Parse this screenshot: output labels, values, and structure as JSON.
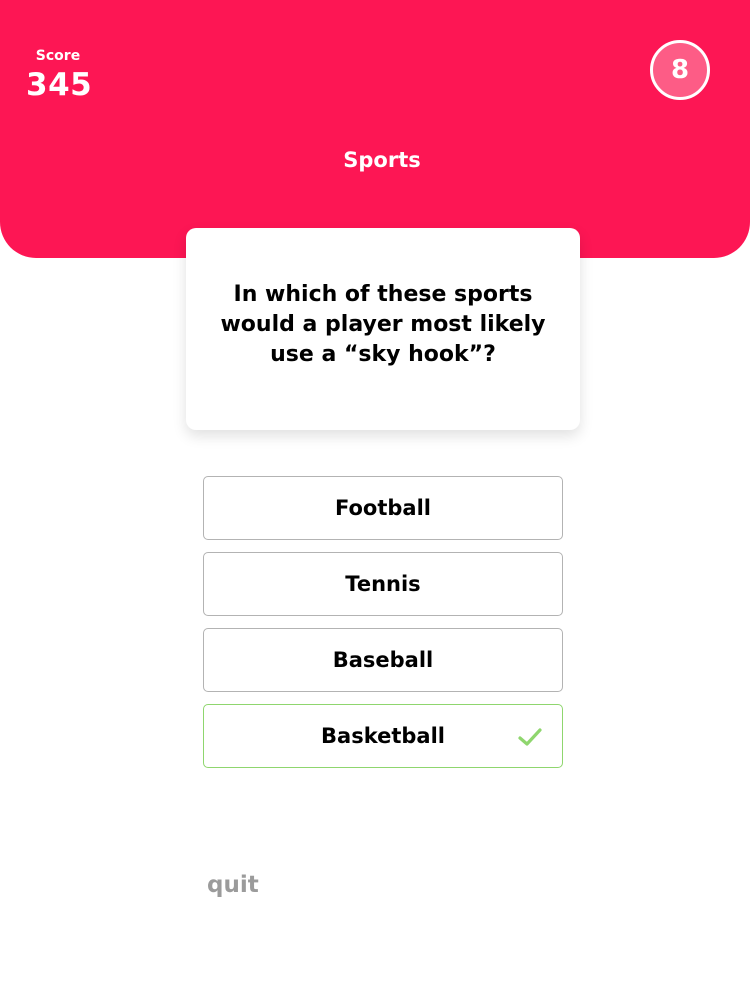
{
  "header": {
    "score_label": "Score",
    "score_value": "345",
    "timer_value": "8",
    "category": "Sports"
  },
  "question": {
    "text": "In which of these sports would a player most likely use a “sky hook”?"
  },
  "answers": [
    {
      "label": "Football",
      "state": "default"
    },
    {
      "label": "Tennis",
      "state": "default"
    },
    {
      "label": "Baseball",
      "state": "default"
    },
    {
      "label": "Basketball",
      "state": "correct"
    }
  ],
  "footer": {
    "quit_label": "quit"
  },
  "colors": {
    "brand_red": "#fd1654",
    "timer_bg": "#fd5c86",
    "correct_green": "#8fd66e",
    "answer_border": "#b3b3b3",
    "quit_gray": "#9b9b9b"
  },
  "icons": {
    "correct_mark": "check-icon"
  }
}
